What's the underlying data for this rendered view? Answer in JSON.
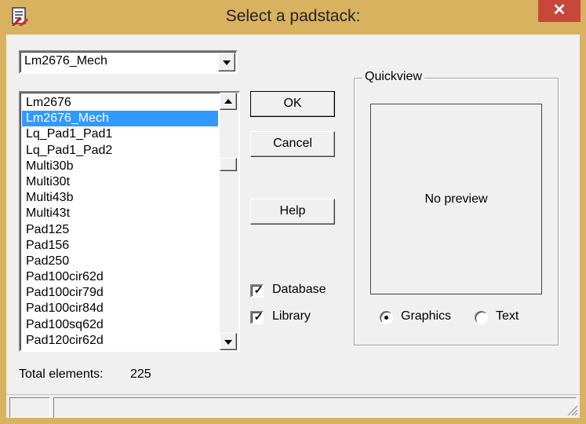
{
  "window": {
    "title": "Select a padstack:",
    "close_label": "✕"
  },
  "combo": {
    "selected": "Lm2676_Mech"
  },
  "list": {
    "items": [
      "Lm2676",
      "Lm2676_Mech",
      "Lq_Pad1_Pad1",
      "Lq_Pad1_Pad2",
      "Multi30b",
      "Multi30t",
      "Multi43b",
      "Multi43t",
      "Pad125",
      "Pad156",
      "Pad250",
      "Pad100cir62d",
      "Pad100cir79d",
      "Pad100cir84d",
      "Pad100sq62d",
      "Pad120cir62d"
    ],
    "selected_index": 1
  },
  "buttons": {
    "ok": "OK",
    "cancel": "Cancel",
    "help": "Help"
  },
  "checkboxes": {
    "database": {
      "label": "Database",
      "checked": true,
      "mark": "✓"
    },
    "library": {
      "label": "Library",
      "checked": true,
      "mark": "✓"
    }
  },
  "quickview": {
    "title": "Quickview",
    "preview_text": "No preview",
    "graphics_label": "Graphics",
    "text_label": "Text",
    "selected_mode": "Graphics"
  },
  "footer": {
    "total_label": "Total elements:",
    "total_value": "225"
  },
  "colors": {
    "titlebar": "#d9b260",
    "close": "#c7483a",
    "selection": "#3399ff",
    "dialog_bg": "#f0f0f0"
  }
}
